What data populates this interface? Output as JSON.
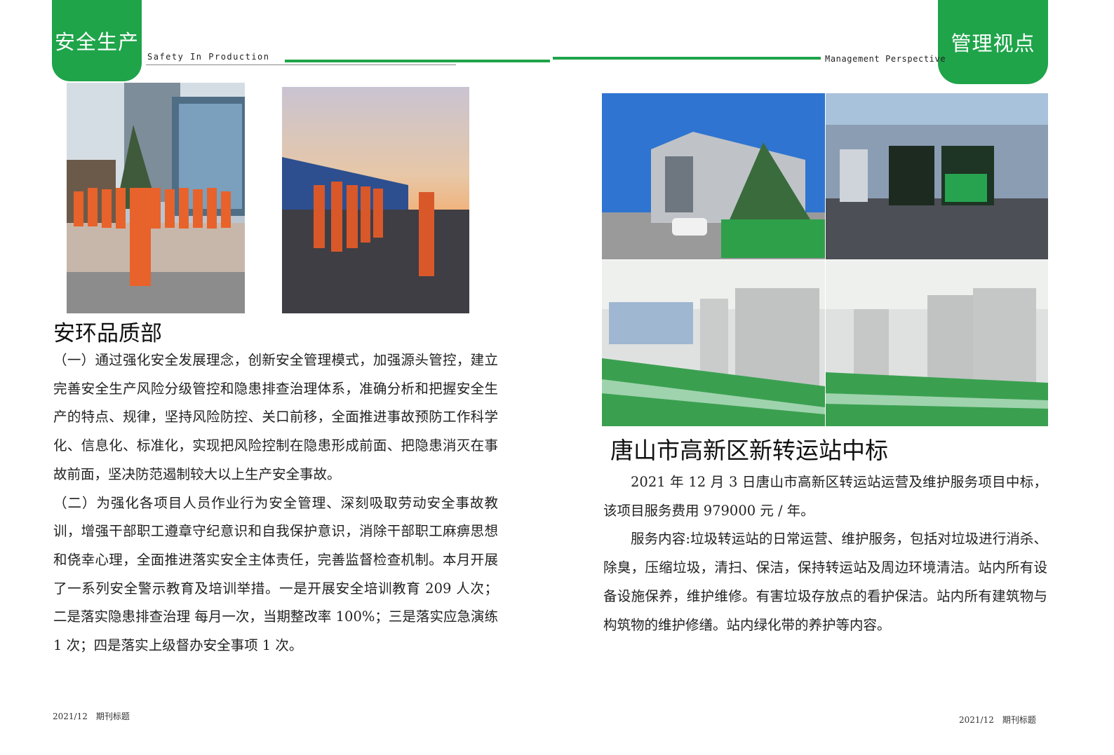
{
  "header": {
    "left_tab": "安全生产",
    "left_subtitle": "Safety  In  Production",
    "right_tab": "管理视点",
    "right_subtitle": "Management Perspective",
    "accent_color": "#1fa44a"
  },
  "left": {
    "heading": "安环品质部",
    "paragraphs": [
      "（一）通过强化安全发展理念，创新安全管理模式，加强源头管控，建立完善安全生产风险分级管控和隐患排查治理体系，准确分析和把握安全生产的特点、规律，坚持风险防控、关口前移，全面推进事故预防工作科学化、信息化、标准化，实现把风险控制在隐患形成前面、把隐患消灭在事故前面，坚决防范遏制较大以上生产安全事故。",
      "（二）为强化各项目人员作业行为安全管理、深刻吸取劳动安全事故教训，增强干部职工遵章守纪意识和自我保护意识，消除干部职工麻痹思想和侥幸心理，全面推进落实安全主体责任，完善监督检查机制。本月开展了一系列安全警示教育及培训举措。一是开展安全培训教育 209 人次；二是落实隐患排查治理 每月一次，当期整改率 100%；三是落实应急演练 1 次；四是落实上级督办安全事项 1 次。"
    ]
  },
  "right": {
    "heading": "唐山市高新区新转运站中标",
    "paragraphs": [
      "2021 年 12 月 3 日唐山市高新区转运站运营及维护服务项目中标，该项目服务费用 979000 元 / 年。",
      "服务内容:垃圾转运站的日常运营、维护服务，包括对垃圾进行消杀、除臭，压缩垃圾，清扫、保洁，保持转运站及周边环境清洁。站内所有设备设施保养，维护维修。有害垃圾存放点的看护保洁。站内所有建筑物与构筑物的维护修缮。站内绿化带的养护等内容。"
    ]
  },
  "footer": {
    "left": "2021/12　期刊标题",
    "right": "2021/12　期刊标题"
  }
}
